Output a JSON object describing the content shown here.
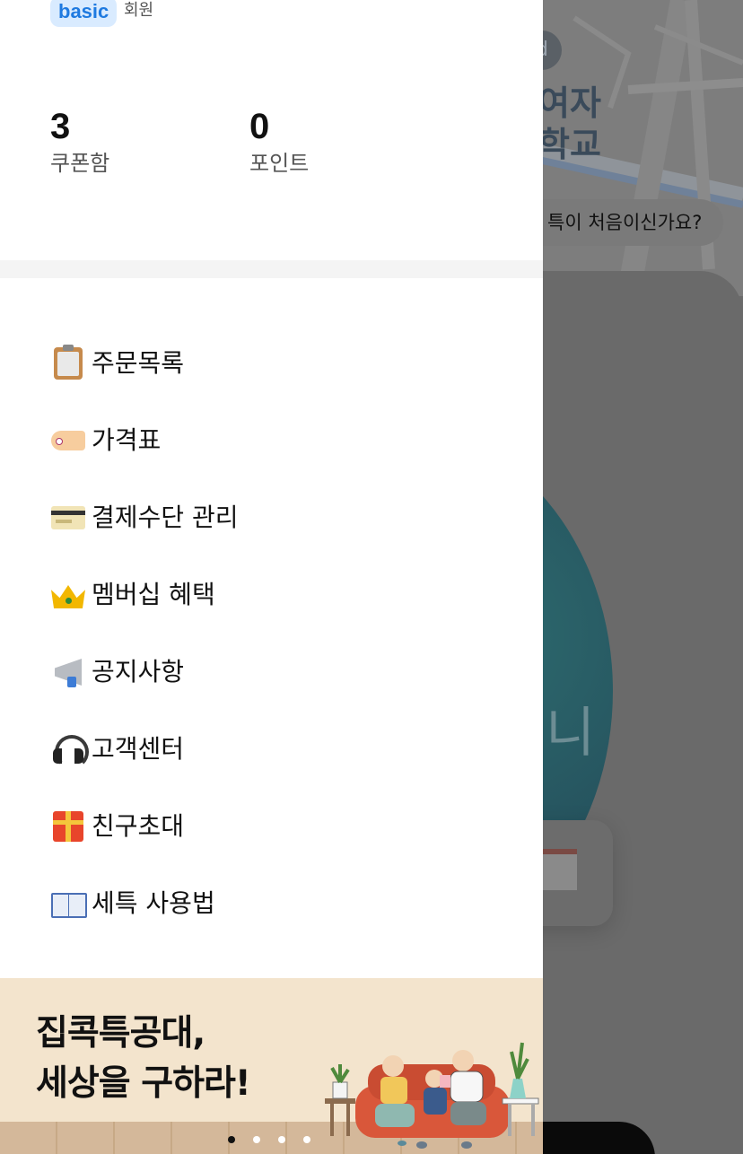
{
  "background": {
    "map_label_lines": [
      "여자",
      "학교"
    ],
    "map_badge_text": "d",
    "first_time_pill": "특이 처음이신가요?",
    "circle_text": "니"
  },
  "drawer": {
    "profile": {
      "grade_badge": "basic",
      "grade_suffix": "회원",
      "coupon_count": "3",
      "coupon_label": "쿠폰함",
      "point_count": "0",
      "point_label": "포인트"
    },
    "menu": [
      {
        "icon": "clipboard-icon",
        "label": "주문목록"
      },
      {
        "icon": "price-tag-icon",
        "label": "가격표"
      },
      {
        "icon": "credit-card-icon",
        "label": "결제수단 관리"
      },
      {
        "icon": "crown-icon",
        "label": "멤버십 혜택"
      },
      {
        "icon": "megaphone-icon",
        "label": "공지사항"
      },
      {
        "icon": "headphones-icon",
        "label": "고객센터"
      },
      {
        "icon": "gift-icon",
        "label": "친구초대"
      },
      {
        "icon": "open-book-icon",
        "label": "세특 사용법"
      }
    ],
    "banner": {
      "line1": "집콕특공대,",
      "line2": "세상을 구하라!",
      "page_count": 4,
      "active_page": 1
    }
  },
  "colors": {
    "grade_badge_bg": "#d9ebff",
    "grade_badge_text": "#1f7ae0",
    "banner_bg": "#f3e4cd",
    "overlay": "#6b6b6b"
  }
}
